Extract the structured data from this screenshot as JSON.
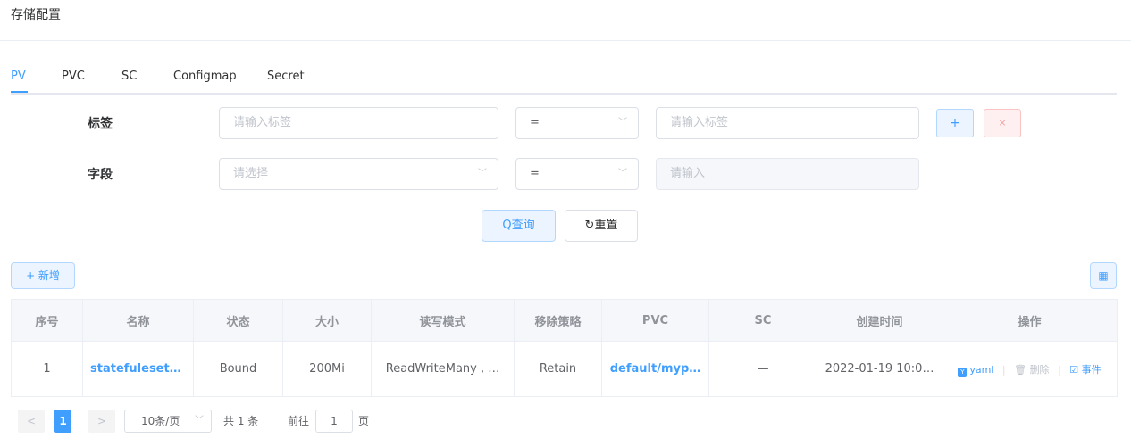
{
  "page": {
    "title": "存储配置"
  },
  "tabs": [
    {
      "label": "PV",
      "active": true
    },
    {
      "label": "PVC",
      "active": false
    },
    {
      "label": "SC",
      "active": false
    },
    {
      "label": "Configmap",
      "active": false
    },
    {
      "label": "Secret",
      "active": false
    }
  ],
  "filters": {
    "label_row": {
      "label": "标签",
      "key_placeholder": "请输入标签",
      "operator": "=",
      "value_placeholder": "请输入标签",
      "add_icon": "+",
      "remove_icon": "×"
    },
    "field_row": {
      "label": "字段",
      "key_placeholder": "请选择",
      "operator": "=",
      "value_placeholder": "请输入"
    }
  },
  "actions": {
    "query": "Q查询",
    "reset": "↻重置",
    "new": "+ 新增",
    "columns_icon": "▦"
  },
  "table": {
    "columns": [
      "序号",
      "名称",
      "状态",
      "大小",
      "读写模式",
      "移除策略",
      "PVC",
      "SC",
      "创建时间",
      "操作"
    ],
    "rows": [
      {
        "index": "1",
        "name": "statefuleset-…",
        "status": "Bound",
        "size": "200Mi",
        "access_mode": "ReadWriteMany , …",
        "reclaim_policy": "Retain",
        "pvc": "default/myp…",
        "sc": "—",
        "created": "2022-01-19 10:0…",
        "ops": {
          "yaml": "yaml",
          "delete": "删除",
          "events": "事件"
        }
      }
    ]
  },
  "pagination": {
    "prev": "<",
    "current": "1",
    "next": ">",
    "page_size": "10条/页",
    "total": "共 1 条",
    "goto_prefix": "前往",
    "goto_value": "1",
    "goto_suffix": "页"
  },
  "colors": {
    "primary": "#409eff",
    "danger": "#f56c6c"
  }
}
